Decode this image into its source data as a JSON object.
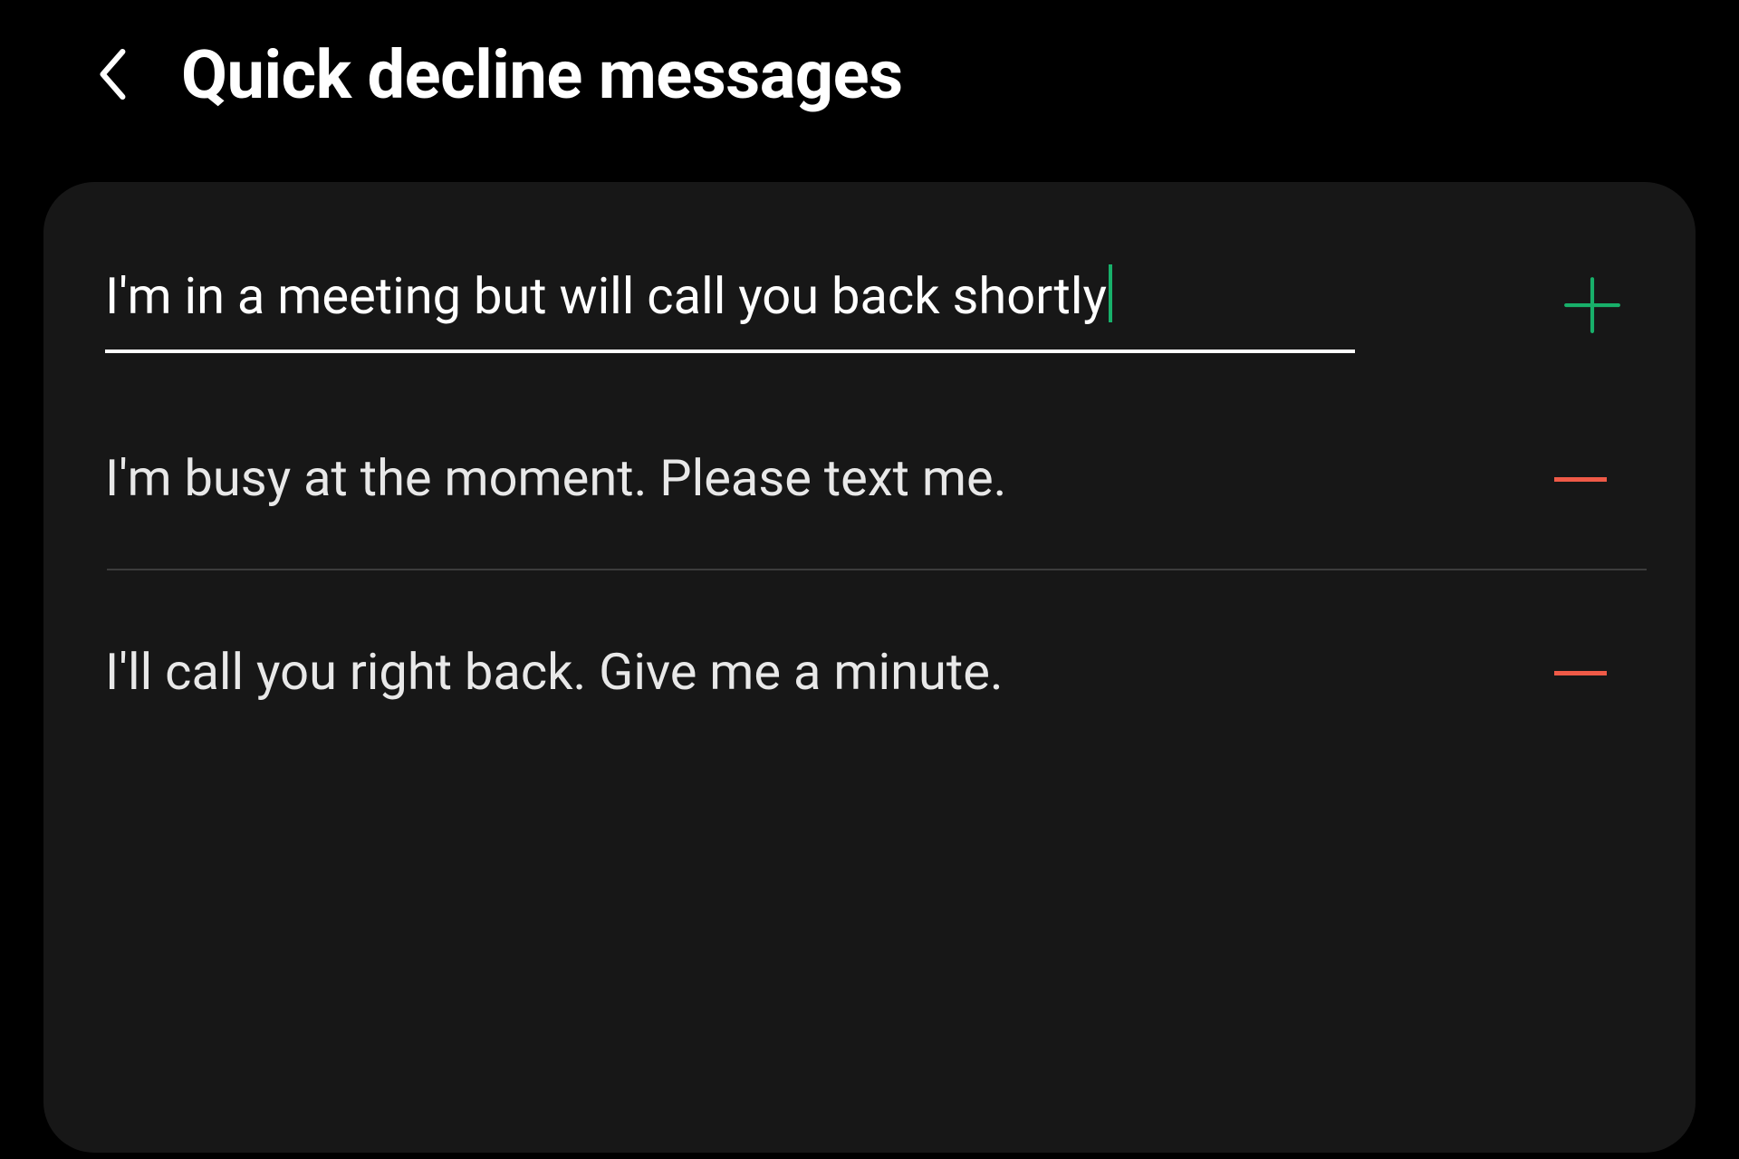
{
  "header": {
    "title": "Quick decline messages"
  },
  "input": {
    "value": "I'm in a meeting but will call you back shortly"
  },
  "messages": [
    {
      "text": "I'm busy at the moment. Please text me."
    },
    {
      "text": "I'll call you right back. Give me a minute."
    }
  ],
  "icons": {
    "back": "chevron-left-icon",
    "add": "plus-icon",
    "remove": "minus-icon"
  },
  "colors": {
    "accent_green": "#18b06a",
    "accent_red": "#ef5a47",
    "background": "#000000",
    "panel": "#171717"
  }
}
